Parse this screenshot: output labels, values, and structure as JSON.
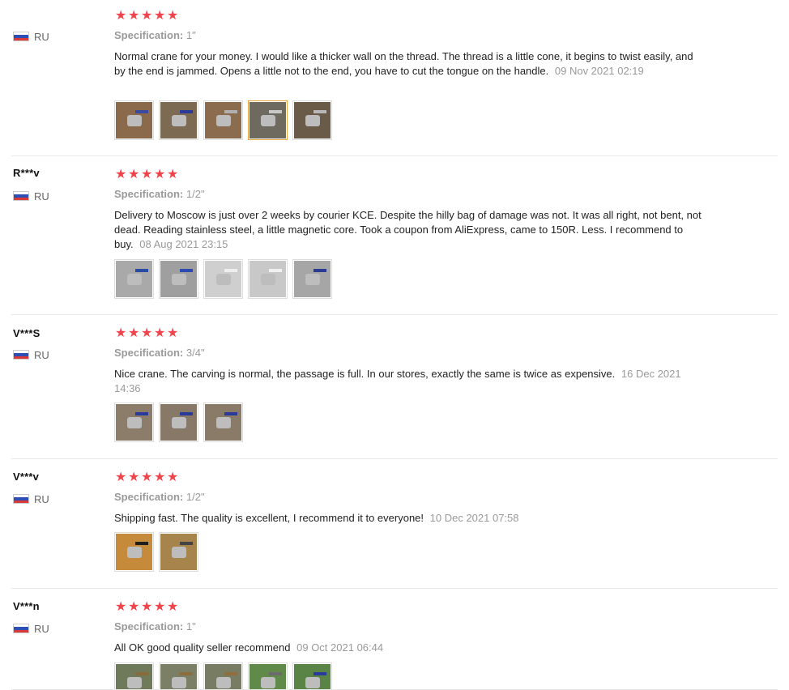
{
  "colors": {
    "star": "#f0434b",
    "muted": "#999999",
    "divider": "#e8e8e8",
    "active_thumb": "#e9a13b"
  },
  "icons": {
    "star": "star-icon",
    "flag": "russia-flag-icon"
  },
  "reviews": [
    {
      "user": "",
      "country": "RU",
      "rating": 5,
      "spec_label": "Specification:",
      "spec_value": "1\"",
      "text": "Normal crane for your money. I would like a thicker wall on the thread. The thread is a little cone, it begins to twist easily, and by the end is jammed. Opens a little not to the end, you have to cut the tongue on the handle.",
      "date": "09 Nov 2021 02:19",
      "thumbs": [
        {
          "bg": "#8a6a4a",
          "fg": "#3a4aa0"
        },
        {
          "bg": "#7c6a52",
          "fg": "#2a3a9a"
        },
        {
          "bg": "#8c6c4e",
          "fg": "#b0b0b0"
        },
        {
          "bg": "#6f6a5f",
          "fg": "#c9c9c9",
          "active": true
        },
        {
          "bg": "#6a5a48",
          "fg": "#b8b8b8"
        }
      ]
    },
    {
      "user": "R***v",
      "country": "RU",
      "rating": 5,
      "spec_label": "Specification:",
      "spec_value": "1/2\"",
      "text": "Delivery to Moscow is just over 2 weeks by courier KCE. Despite the hilly bag of damage was not. It was all right, not bent, not dead. Reading stainless steel, a little magnetic core. Took a coupon from AliExpress, came to 150R. Less. I recommend to buy.",
      "date": "08 Aug 2021 23:15",
      "thumbs": [
        {
          "bg": "#a9a9a9",
          "fg": "#2a4aa6"
        },
        {
          "bg": "#9f9f9f",
          "fg": "#2c4ab0"
        },
        {
          "bg": "#cfcfcf",
          "fg": "#eeeeee"
        },
        {
          "bg": "#c8c8c8",
          "fg": "#f1f1f1"
        },
        {
          "bg": "#a6a6a6",
          "fg": "#2a3a90"
        }
      ]
    },
    {
      "user": "V***S",
      "country": "RU",
      "rating": 5,
      "spec_label": "Specification:",
      "spec_value": "3/4\"",
      "text": "Nice crane. The carving is normal, the passage is full. In our stores, exactly the same is twice as expensive.",
      "date": "16 Dec 2021 14:36",
      "thumbs": [
        {
          "bg": "#8c7d6a",
          "fg": "#2a3a9a"
        },
        {
          "bg": "#877867",
          "fg": "#2a3a9a"
        },
        {
          "bg": "#8a7b69",
          "fg": "#2a3a9a"
        }
      ]
    },
    {
      "user": "V***v",
      "country": "RU",
      "rating": 5,
      "spec_label": "Specification:",
      "spec_value": "1/2\"",
      "text": "Shipping fast. The quality is excellent, I recommend it to everyone!",
      "date": "10 Dec 2021 07:58",
      "thumbs": [
        {
          "bg": "#c58a3a",
          "fg": "#1e1e1e"
        },
        {
          "bg": "#a8844d",
          "fg": "#444444"
        }
      ]
    },
    {
      "user": "V***n",
      "country": "RU",
      "rating": 5,
      "spec_label": "Specification:",
      "spec_value": "1\"",
      "text": "All OK good quality seller recommend",
      "date": "09 Oct 2021 06:44",
      "thumbs": [
        {
          "bg": "#6f7a5a",
          "fg": "#8a6a3a"
        },
        {
          "bg": "#7a7f66",
          "fg": "#8c6c3a"
        },
        {
          "bg": "#787c62",
          "fg": "#8e6e3c"
        },
        {
          "bg": "#5f8a4a",
          "fg": "#6b6b6b"
        },
        {
          "bg": "#5a8446",
          "fg": "#2a3a9a"
        }
      ]
    }
  ]
}
